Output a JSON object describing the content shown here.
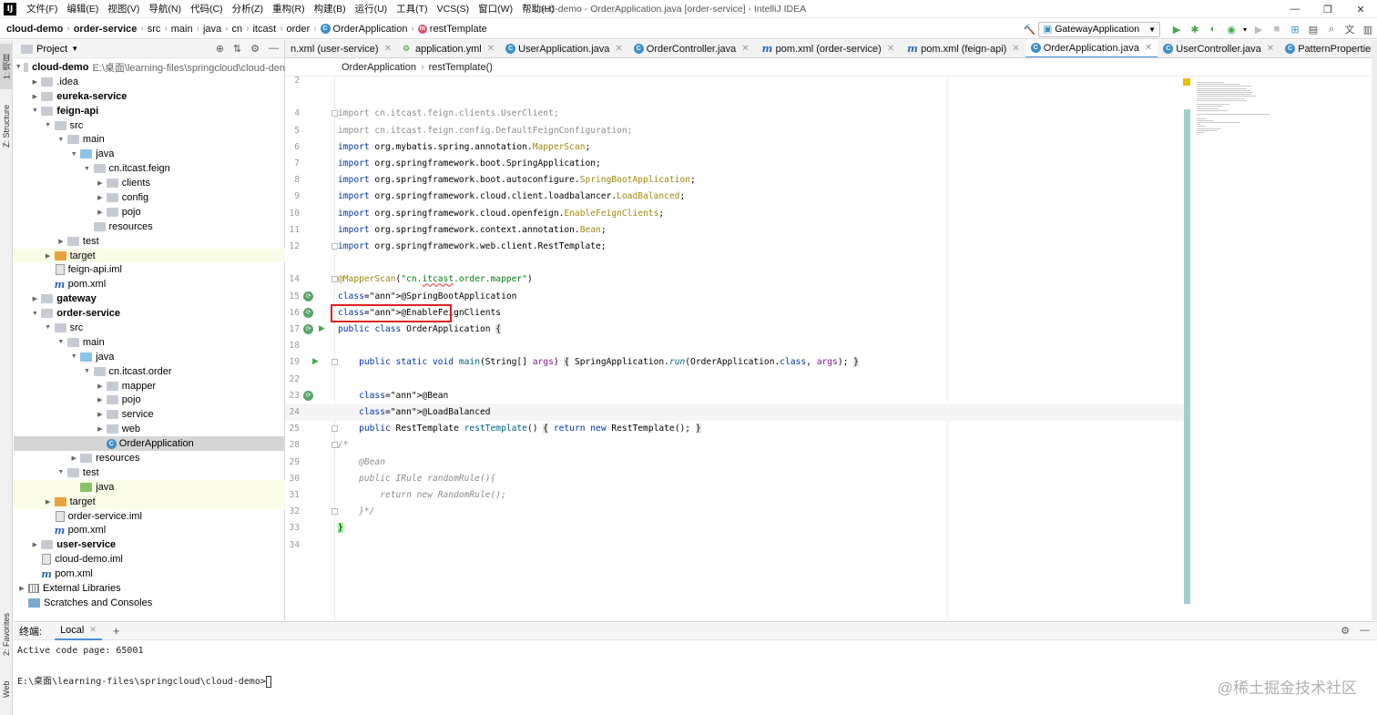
{
  "titlebar": {
    "logo": "IJ",
    "menus": [
      "文件(F)",
      "编辑(E)",
      "视图(V)",
      "导航(N)",
      "代码(C)",
      "分析(Z)",
      "重构(R)",
      "构建(B)",
      "运行(U)",
      "工具(T)",
      "VCS(S)",
      "窗口(W)",
      "帮助(H)"
    ],
    "window_title": "cloud-demo - OrderApplication.java [order-service] - IntelliJ IDEA"
  },
  "navbar": {
    "crumbs": [
      "cloud-demo",
      "order-service",
      "src",
      "main",
      "java",
      "cn",
      "itcast",
      "order",
      "OrderApplication",
      "restTemplate"
    ],
    "run_config": "GatewayApplication"
  },
  "left_strip": {
    "project_tab": "1: 项目",
    "structure_tab": "Z: Structure",
    "favorites_tab": "2: Favorites",
    "web_tab": "Web"
  },
  "project_panel": {
    "title": "Project",
    "tree": [
      {
        "label": "cloud-demo",
        "path": "E:\\桌面\\learning-files\\springcloud\\cloud-den",
        "indent": 0,
        "arrow": "down",
        "icon": "mod",
        "bold": true
      },
      {
        "label": ".idea",
        "indent": 1,
        "arrow": "right",
        "icon": "folder"
      },
      {
        "label": "eureka-service",
        "indent": 1,
        "arrow": "right",
        "icon": "mod",
        "bold": true
      },
      {
        "label": "feign-api",
        "indent": 1,
        "arrow": "down",
        "icon": "mod",
        "bold": true
      },
      {
        "label": "src",
        "indent": 2,
        "arrow": "down",
        "icon": "folder"
      },
      {
        "label": "main",
        "indent": 3,
        "arrow": "down",
        "icon": "folder"
      },
      {
        "label": "java",
        "indent": 4,
        "arrow": "down",
        "icon": "blue"
      },
      {
        "label": "cn.itcast.feign",
        "indent": 5,
        "arrow": "down",
        "icon": "folder"
      },
      {
        "label": "clients",
        "indent": 6,
        "arrow": "right",
        "icon": "folder"
      },
      {
        "label": "config",
        "indent": 6,
        "arrow": "right",
        "icon": "folder"
      },
      {
        "label": "pojo",
        "indent": 6,
        "arrow": "right",
        "icon": "folder"
      },
      {
        "label": "resources",
        "indent": 5,
        "arrow": "",
        "icon": "folder"
      },
      {
        "label": "test",
        "indent": 3,
        "arrow": "right",
        "icon": "folder"
      },
      {
        "label": "target",
        "indent": 2,
        "arrow": "right",
        "icon": "orange",
        "hl": true
      },
      {
        "label": "feign-api.iml",
        "indent": 2,
        "arrow": "",
        "icon": "file"
      },
      {
        "label": "pom.xml",
        "indent": 2,
        "arrow": "",
        "icon": "m"
      },
      {
        "label": "gateway",
        "indent": 1,
        "arrow": "right",
        "icon": "mod",
        "bold": true
      },
      {
        "label": "order-service",
        "indent": 1,
        "arrow": "down",
        "icon": "mod",
        "bold": true
      },
      {
        "label": "src",
        "indent": 2,
        "arrow": "down",
        "icon": "folder"
      },
      {
        "label": "main",
        "indent": 3,
        "arrow": "down",
        "icon": "folder"
      },
      {
        "label": "java",
        "indent": 4,
        "arrow": "down",
        "icon": "blue"
      },
      {
        "label": "cn.itcast.order",
        "indent": 5,
        "arrow": "down",
        "icon": "folder"
      },
      {
        "label": "mapper",
        "indent": 6,
        "arrow": "right",
        "icon": "folder"
      },
      {
        "label": "pojo",
        "indent": 6,
        "arrow": "right",
        "icon": "folder"
      },
      {
        "label": "service",
        "indent": 6,
        "arrow": "right",
        "icon": "folder"
      },
      {
        "label": "web",
        "indent": 6,
        "arrow": "right",
        "icon": "folder"
      },
      {
        "label": "OrderApplication",
        "indent": 6,
        "arrow": "",
        "icon": "class",
        "selected": true
      },
      {
        "label": "resources",
        "indent": 4,
        "arrow": "right",
        "icon": "folder"
      },
      {
        "label": "test",
        "indent": 3,
        "arrow": "down",
        "icon": "folder"
      },
      {
        "label": "java",
        "indent": 4,
        "arrow": "",
        "icon": "green",
        "hl": true
      },
      {
        "label": "target",
        "indent": 2,
        "arrow": "right",
        "icon": "orange",
        "hl": true
      },
      {
        "label": "order-service.iml",
        "indent": 2,
        "arrow": "",
        "icon": "file"
      },
      {
        "label": "pom.xml",
        "indent": 2,
        "arrow": "",
        "icon": "m"
      },
      {
        "label": "user-service",
        "indent": 1,
        "arrow": "right",
        "icon": "mod",
        "bold": true
      },
      {
        "label": "cloud-demo.iml",
        "indent": 1,
        "arrow": "",
        "icon": "file"
      },
      {
        "label": "pom.xml",
        "indent": 1,
        "arrow": "",
        "icon": "m"
      },
      {
        "label": "External Libraries",
        "indent": 0,
        "arrow": "right",
        "icon": "lib"
      },
      {
        "label": "Scratches and Consoles",
        "indent": 0,
        "arrow": "",
        "icon": "scratch"
      }
    ]
  },
  "tabs": [
    {
      "label": "n.xml (user-service)",
      "icon": ""
    },
    {
      "label": "application.yml",
      "icon": "yml"
    },
    {
      "label": "UserApplication.java",
      "icon": "class"
    },
    {
      "label": "OrderController.java",
      "icon": "class"
    },
    {
      "label": "pom.xml (order-service)",
      "icon": "m"
    },
    {
      "label": "pom.xml (feign-api)",
      "icon": "m"
    },
    {
      "label": "OrderApplication.java",
      "icon": "class",
      "active": true
    },
    {
      "label": "UserController.java",
      "icon": "class"
    },
    {
      "label": "PatternProperties.java",
      "icon": "class"
    }
  ],
  "editor_breadcrumb": [
    "OrderApplication",
    "restTemplate()"
  ],
  "editor": {
    "line_numbers": [
      "2",
      "",
      "4",
      "5",
      "6",
      "7",
      "8",
      "9",
      "10",
      "11",
      "12",
      "",
      "14",
      "15",
      "16",
      "17",
      "18",
      "19",
      "22",
      "23",
      "24",
      "25",
      "28",
      "29",
      "30",
      "31",
      "32",
      "33",
      "34"
    ],
    "code_lines": [
      "",
      "",
      "import cn.itcast.feign.clients.UserClient;",
      "import cn.itcast.feign.config.DefaultFeignConfiguration;",
      "import org.mybatis.spring.annotation.MapperScan;",
      "import org.springframework.boot.SpringApplication;",
      "import org.springframework.boot.autoconfigure.SpringBootApplication;",
      "import org.springframework.cloud.client.loadbalancer.LoadBalanced;",
      "import org.springframework.cloud.openfeign.EnableFeignClients;",
      "import org.springframework.context.annotation.Bean;",
      "import org.springframework.web.client.RestTemplate;",
      "",
      "@MapperScan(\"cn.itcast.order.mapper\")",
      "@SpringBootApplication",
      "@EnableFeignClients",
      "public class OrderApplication {",
      "",
      "    public static void main(String[] args) { SpringApplication.run(OrderApplication.class, args); }",
      "",
      "    @Bean",
      "    @LoadBalanced",
      "    public RestTemplate restTemplate() { return new RestTemplate(); }",
      "/*",
      "    @Bean",
      "    public IRule randomRule(){",
      "        return new RandomRule();",
      "    }*/",
      "}",
      ""
    ]
  },
  "terminal": {
    "title": "终端:",
    "tab": "Local",
    "add": "+",
    "lines": [
      "Active code page: 65001",
      "",
      "E:\\桌面\\learning-files\\springcloud\\cloud-demo>"
    ],
    "watermark": "@稀土掘金技术社区"
  },
  "colors": {
    "accent": "#4a90d9",
    "highlight_box": "#e02020",
    "selected_row": "#d5d5d5"
  }
}
